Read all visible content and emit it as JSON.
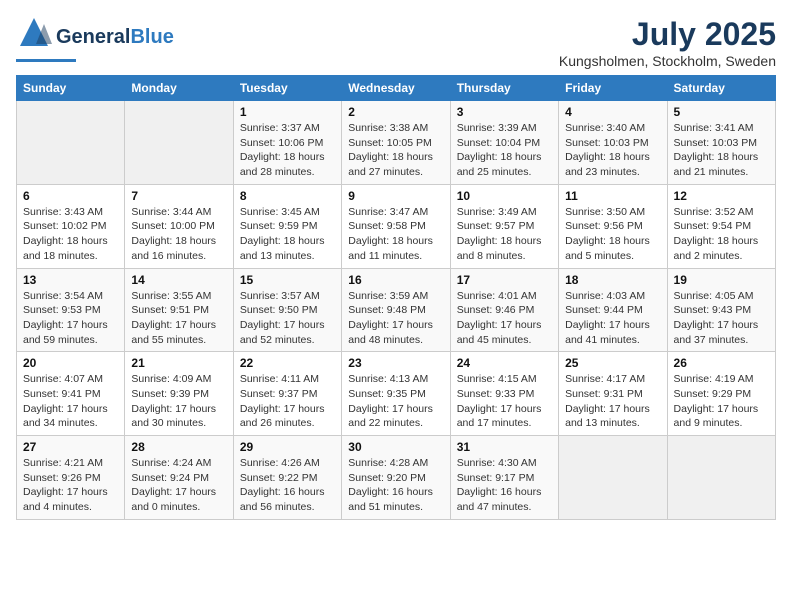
{
  "header": {
    "logo_general": "General",
    "logo_blue": "Blue",
    "month_title": "July 2025",
    "location": "Kungsholmen, Stockholm, Sweden"
  },
  "weekdays": [
    "Sunday",
    "Monday",
    "Tuesday",
    "Wednesday",
    "Thursday",
    "Friday",
    "Saturday"
  ],
  "weeks": [
    [
      {
        "day": "",
        "info": ""
      },
      {
        "day": "",
        "info": ""
      },
      {
        "day": "1",
        "info": "Sunrise: 3:37 AM\nSunset: 10:06 PM\nDaylight: 18 hours\nand 28 minutes."
      },
      {
        "day": "2",
        "info": "Sunrise: 3:38 AM\nSunset: 10:05 PM\nDaylight: 18 hours\nand 27 minutes."
      },
      {
        "day": "3",
        "info": "Sunrise: 3:39 AM\nSunset: 10:04 PM\nDaylight: 18 hours\nand 25 minutes."
      },
      {
        "day": "4",
        "info": "Sunrise: 3:40 AM\nSunset: 10:03 PM\nDaylight: 18 hours\nand 23 minutes."
      },
      {
        "day": "5",
        "info": "Sunrise: 3:41 AM\nSunset: 10:03 PM\nDaylight: 18 hours\nand 21 minutes."
      }
    ],
    [
      {
        "day": "6",
        "info": "Sunrise: 3:43 AM\nSunset: 10:02 PM\nDaylight: 18 hours\nand 18 minutes."
      },
      {
        "day": "7",
        "info": "Sunrise: 3:44 AM\nSunset: 10:00 PM\nDaylight: 18 hours\nand 16 minutes."
      },
      {
        "day": "8",
        "info": "Sunrise: 3:45 AM\nSunset: 9:59 PM\nDaylight: 18 hours\nand 13 minutes."
      },
      {
        "day": "9",
        "info": "Sunrise: 3:47 AM\nSunset: 9:58 PM\nDaylight: 18 hours\nand 11 minutes."
      },
      {
        "day": "10",
        "info": "Sunrise: 3:49 AM\nSunset: 9:57 PM\nDaylight: 18 hours\nand 8 minutes."
      },
      {
        "day": "11",
        "info": "Sunrise: 3:50 AM\nSunset: 9:56 PM\nDaylight: 18 hours\nand 5 minutes."
      },
      {
        "day": "12",
        "info": "Sunrise: 3:52 AM\nSunset: 9:54 PM\nDaylight: 18 hours\nand 2 minutes."
      }
    ],
    [
      {
        "day": "13",
        "info": "Sunrise: 3:54 AM\nSunset: 9:53 PM\nDaylight: 17 hours\nand 59 minutes."
      },
      {
        "day": "14",
        "info": "Sunrise: 3:55 AM\nSunset: 9:51 PM\nDaylight: 17 hours\nand 55 minutes."
      },
      {
        "day": "15",
        "info": "Sunrise: 3:57 AM\nSunset: 9:50 PM\nDaylight: 17 hours\nand 52 minutes."
      },
      {
        "day": "16",
        "info": "Sunrise: 3:59 AM\nSunset: 9:48 PM\nDaylight: 17 hours\nand 48 minutes."
      },
      {
        "day": "17",
        "info": "Sunrise: 4:01 AM\nSunset: 9:46 PM\nDaylight: 17 hours\nand 45 minutes."
      },
      {
        "day": "18",
        "info": "Sunrise: 4:03 AM\nSunset: 9:44 PM\nDaylight: 17 hours\nand 41 minutes."
      },
      {
        "day": "19",
        "info": "Sunrise: 4:05 AM\nSunset: 9:43 PM\nDaylight: 17 hours\nand 37 minutes."
      }
    ],
    [
      {
        "day": "20",
        "info": "Sunrise: 4:07 AM\nSunset: 9:41 PM\nDaylight: 17 hours\nand 34 minutes."
      },
      {
        "day": "21",
        "info": "Sunrise: 4:09 AM\nSunset: 9:39 PM\nDaylight: 17 hours\nand 30 minutes."
      },
      {
        "day": "22",
        "info": "Sunrise: 4:11 AM\nSunset: 9:37 PM\nDaylight: 17 hours\nand 26 minutes."
      },
      {
        "day": "23",
        "info": "Sunrise: 4:13 AM\nSunset: 9:35 PM\nDaylight: 17 hours\nand 22 minutes."
      },
      {
        "day": "24",
        "info": "Sunrise: 4:15 AM\nSunset: 9:33 PM\nDaylight: 17 hours\nand 17 minutes."
      },
      {
        "day": "25",
        "info": "Sunrise: 4:17 AM\nSunset: 9:31 PM\nDaylight: 17 hours\nand 13 minutes."
      },
      {
        "day": "26",
        "info": "Sunrise: 4:19 AM\nSunset: 9:29 PM\nDaylight: 17 hours\nand 9 minutes."
      }
    ],
    [
      {
        "day": "27",
        "info": "Sunrise: 4:21 AM\nSunset: 9:26 PM\nDaylight: 17 hours\nand 4 minutes."
      },
      {
        "day": "28",
        "info": "Sunrise: 4:24 AM\nSunset: 9:24 PM\nDaylight: 17 hours\nand 0 minutes."
      },
      {
        "day": "29",
        "info": "Sunrise: 4:26 AM\nSunset: 9:22 PM\nDaylight: 16 hours\nand 56 minutes."
      },
      {
        "day": "30",
        "info": "Sunrise: 4:28 AM\nSunset: 9:20 PM\nDaylight: 16 hours\nand 51 minutes."
      },
      {
        "day": "31",
        "info": "Sunrise: 4:30 AM\nSunset: 9:17 PM\nDaylight: 16 hours\nand 47 minutes."
      },
      {
        "day": "",
        "info": ""
      },
      {
        "day": "",
        "info": ""
      }
    ]
  ]
}
